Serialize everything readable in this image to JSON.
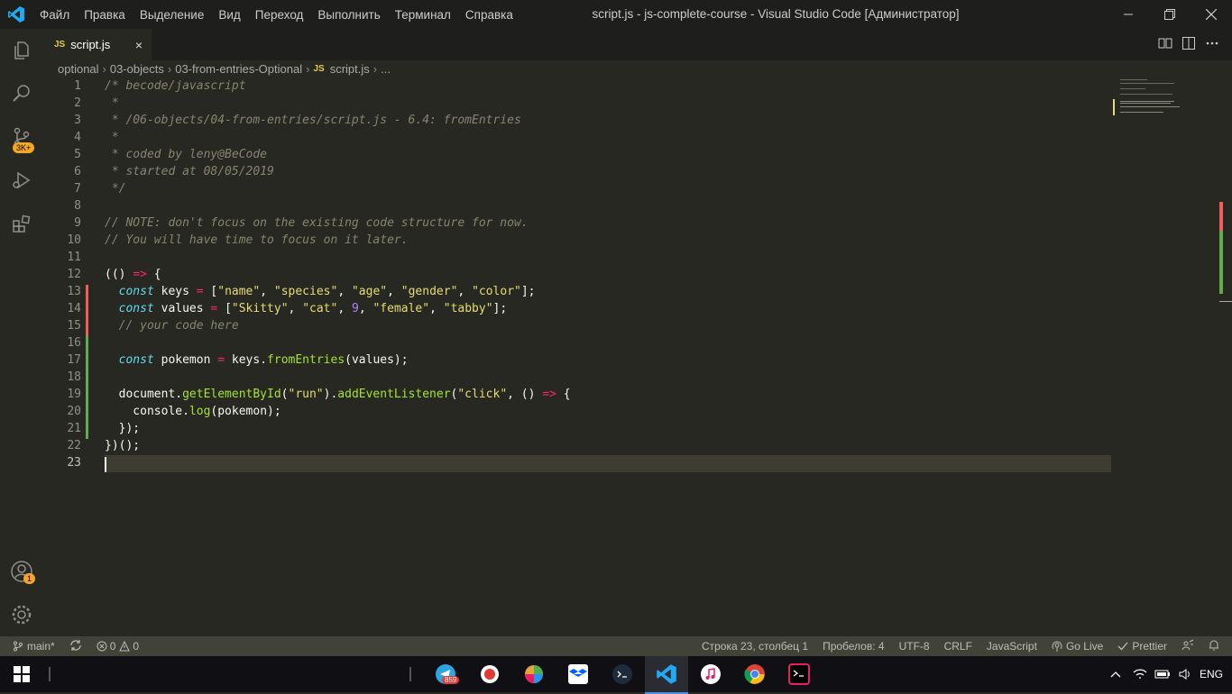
{
  "window": {
    "menu": [
      "Файл",
      "Правка",
      "Выделение",
      "Вид",
      "Переход",
      "Выполнить",
      "Терминал",
      "Справка"
    ],
    "title": "script.js - js-complete-course - Visual Studio Code [Администратор]"
  },
  "activity": {
    "source_control_badge": "3K+",
    "account_badge": "1"
  },
  "tab": {
    "icon_text": "JS",
    "label": "script.js",
    "close": "×"
  },
  "breadcrumb": [
    "optional",
    "03-objects",
    "03-from-entries-Optional",
    "script.js",
    "..."
  ],
  "breadcrumb_icon": "JS",
  "status": {
    "branch": "main*",
    "errors": "0",
    "warnings": "0",
    "position": "Строка 23, столбец 1",
    "indent": "Пробелов: 4",
    "encoding": "UTF-8",
    "eol": "CRLF",
    "language": "JavaScript",
    "golive": "Go Live",
    "prettier": "Prettier"
  },
  "taskbar": {
    "telegram_badge": "859",
    "lang": "ENG"
  },
  "line_numbers": [
    "1",
    "2",
    "3",
    "4",
    "5",
    "6",
    "7",
    "8",
    "9",
    "10",
    "11",
    "12",
    "13",
    "14",
    "15",
    "16",
    "17",
    "18",
    "19",
    "20",
    "21",
    "22",
    "23"
  ],
  "colors": {
    "comment": "#88846f",
    "keyword": "#66d9ef",
    "string": "#e6db74",
    "number": "#ae81ff",
    "operator": "#f92672",
    "function": "#a6e22e"
  }
}
